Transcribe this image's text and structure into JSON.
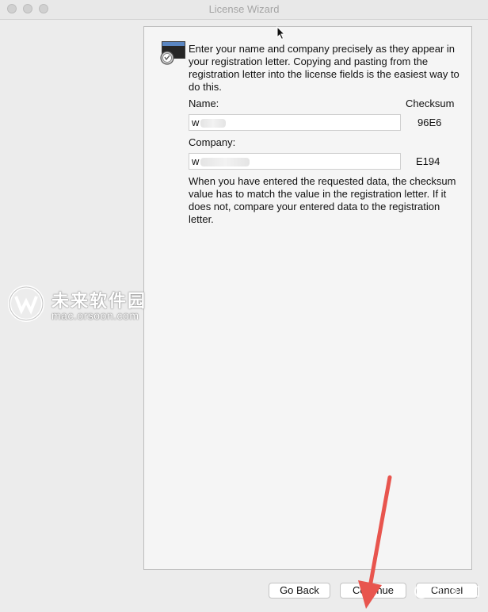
{
  "window": {
    "title": "License Wizard"
  },
  "panel": {
    "intro": "Enter your name and company precisely as they appear in your registration letter.  Copying and pasting from the registration letter into the license fields is the easiest way to do this.",
    "name_label": "Name:",
    "checksum_label": "Checksum",
    "name_value": "w",
    "name_checksum": "96E6",
    "company_label": "Company:",
    "company_value": "w",
    "company_checksum": "E194",
    "note": "When you have entered the requested data, the checksum value has to match the value in the registration letter.  If it does not, compare your entered data to the registration letter."
  },
  "buttons": {
    "go_back": "Go Back",
    "continue": "Continue",
    "cancel": "Cancel"
  },
  "watermark": {
    "site_name": "未来软件园",
    "url": "mac.orsoon.com"
  },
  "colors": {
    "annotation_arrow": "#e8554e"
  }
}
